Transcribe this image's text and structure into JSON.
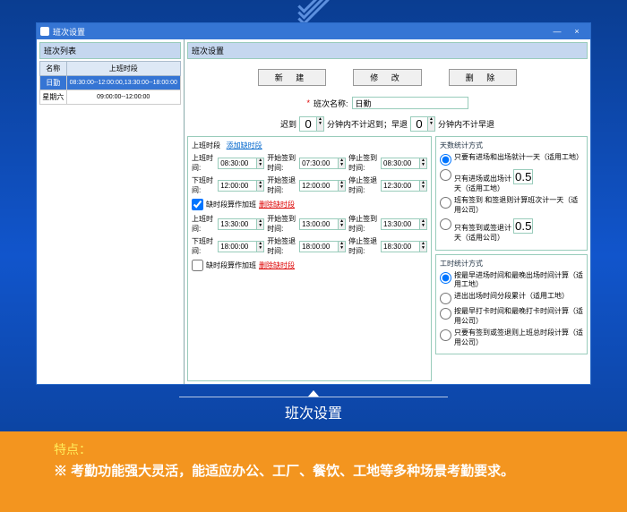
{
  "window": {
    "title": "班次设置",
    "minimize": "—",
    "close": "×"
  },
  "left_panel": {
    "header": "班次列表",
    "cols": {
      "name": "名称",
      "time": "上班时段"
    },
    "rows": [
      {
        "name": "日勤",
        "time": "08:30:00--12:00:00,13:30:00--18:00:00"
      },
      {
        "name": "星期六",
        "time": "09:00:00--12:00:00"
      }
    ]
  },
  "right_panel": {
    "header": "班次设置",
    "buttons": {
      "new": "新 建",
      "edit": "修 改",
      "delete": "删 除"
    },
    "name_label": "班次名称:",
    "name_value": "日勤",
    "late": {
      "l1": "迟到",
      "v1": "0",
      "t1": "分钟内不计迟到；早退",
      "v2": "0",
      "t2": "分钟内不计早退"
    }
  },
  "schedule": {
    "header": "上班时段",
    "add_link": "添加缺时段",
    "del_link": "删除缺时段",
    "labels": {
      "on": "上班时间:",
      "off": "下班时间:",
      "start_sign": "开始签到时间:",
      "stop_sign": "停止签到时间:",
      "start_out": "开始签退时间:",
      "stop_out": "停止签退时间:"
    },
    "seg1": {
      "on": "08:30:00",
      "start_sign": "07:30:00",
      "stop_sign": "08:30:00",
      "off": "12:00:00",
      "start_out": "12:00:00",
      "stop_out": "12:30:00",
      "cb": "缺时段算作加班"
    },
    "seg2": {
      "on": "13:30:00",
      "start_sign": "13:00:00",
      "stop_sign": "13:30:00",
      "off": "18:00:00",
      "start_out": "18:00:00",
      "stop_out": "18:30:00",
      "cb": "缺时段算作加班"
    }
  },
  "days": {
    "header": "天数统计方式",
    "r1": "只要有进场和出场就计一天（适用工地）",
    "r2a": "只有进场或出场计",
    "r2v": "0.5",
    "r2b": "天（适用工地）",
    "r3": "班有签到 和签退则计算班次计一天（适用公司）",
    "r4a": "只有签到或签退计",
    "r4v": "0.5",
    "r4b": "天（适用公司）"
  },
  "worktime": {
    "header": "工时统计方式",
    "r1": "按最早进场时间和最晚出场时间计算（适用工地）",
    "r2": "进出出场时间分段累计（适用工地）",
    "r3": "按最早打卡时间和最晚打卡时间计算（适用公司）",
    "r4": "只要有签到或签退则上班总时段计算（适用公司）"
  },
  "caption": "班次设置",
  "feature": {
    "title": "特点：",
    "desc": "※ 考勤功能强大灵活，能适应办公、工厂、餐饮、工地等多种场景考勤要求。"
  }
}
